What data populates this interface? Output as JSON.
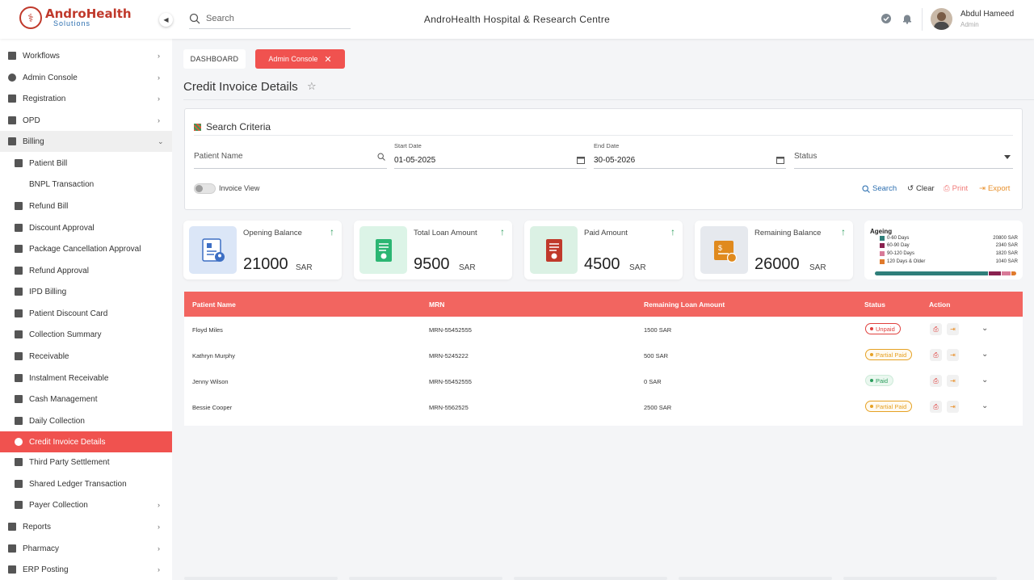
{
  "brand": {
    "name": "AndroHealth",
    "sub": "Solutions"
  },
  "header": {
    "search_placeholder": "Search",
    "hospital": "AndroHealth Hospital & Research Centre",
    "user_name": "Abdul Hameed",
    "user_role": "Admin"
  },
  "sidebar": {
    "items": [
      {
        "label": "Workflows",
        "chev": "›"
      },
      {
        "label": "Admin Console",
        "chev": "›"
      },
      {
        "label": "Registration",
        "chev": "›"
      },
      {
        "label": "OPD",
        "chev": "›"
      },
      {
        "label": "Billing",
        "chev": "⌄"
      },
      {
        "label": "Patient Bill"
      },
      {
        "label": "BNPL Transaction"
      },
      {
        "label": "Refund Bill"
      },
      {
        "label": "Discount Approval"
      },
      {
        "label": "Package Cancellation Approval"
      },
      {
        "label": "Refund Approval"
      },
      {
        "label": "IPD Billing"
      },
      {
        "label": "Patient Discount Card"
      },
      {
        "label": "Collection Summary"
      },
      {
        "label": "Receivable"
      },
      {
        "label": "Instalment Receivable"
      },
      {
        "label": "Cash Management"
      },
      {
        "label": "Daily Collection"
      },
      {
        "label": "Credit Invoice Details"
      },
      {
        "label": "Third Party Settlement"
      },
      {
        "label": "Shared Ledger Transaction"
      },
      {
        "label": "Payer Collection",
        "chev": "›"
      },
      {
        "label": "Reports",
        "chev": "›"
      },
      {
        "label": "Pharmacy",
        "chev": "›"
      },
      {
        "label": "ERP Posting",
        "chev": "›"
      }
    ]
  },
  "tabs": {
    "dashboard": "DASHBOARD",
    "admin": "Admin Console"
  },
  "page_title": "Credit Invoice Details",
  "criteria": {
    "title": "Search Criteria",
    "patient_placeholder": "Patient Name",
    "start_label": "Start Date",
    "start_value": "01-05-2025",
    "end_label": "End Date",
    "end_value": "30-05-2026",
    "status_placeholder": "Status",
    "invoice_view": "Invoice View",
    "actions": {
      "search": "Search",
      "clear": "Clear",
      "print": "Print",
      "export": "Export"
    }
  },
  "cards": [
    {
      "title": "Opening Balance",
      "value": "21000",
      "unit": "SAR",
      "color": "#3d6fc4"
    },
    {
      "title": "Total Loan Amount",
      "value": "9500",
      "unit": "SAR",
      "color": "#2bb673"
    },
    {
      "title": "Paid Amount",
      "value": "4500",
      "unit": "SAR",
      "color": "#c0392b"
    },
    {
      "title": "Remaining Balance",
      "value": "26000",
      "unit": "SAR",
      "color": "#e08a1e"
    }
  ],
  "ageing": {
    "title": "Ageing",
    "rows": [
      {
        "label": "0-60 Days",
        "amount": "20800 SAR",
        "value": 20800,
        "color": "#2f7f7a"
      },
      {
        "label": "60-90 Day",
        "amount": "2340 SAR",
        "value": 2340,
        "color": "#8a2250"
      },
      {
        "label": "90-120 Days",
        "amount": "1820 SAR",
        "value": 1820,
        "color": "#d87a98"
      },
      {
        "label": "120 Days & Older",
        "amount": "1040 SAR",
        "value": 1040,
        "color": "#e07a2c"
      }
    ]
  },
  "table": {
    "headers": [
      "Patient  Name",
      "MRN",
      "Remaining Loan Amount",
      "Status",
      "Action"
    ],
    "rows": [
      {
        "name": "Floyd Miles",
        "mrn": "MRN-55452555",
        "amount": "1500 SAR",
        "status": "Unpaid"
      },
      {
        "name": "Kathryn Murphy",
        "mrn": "MRN-5245222",
        "amount": "500 SAR",
        "status": "Partial Paid"
      },
      {
        "name": "Jenny Wilson",
        "mrn": "MRN-55452555",
        "amount": "0  SAR",
        "status": "Paid"
      },
      {
        "name": "Bessie Cooper",
        "mrn": "MRN-5562525",
        "amount": "2500 SAR",
        "status": "Partial Paid"
      }
    ]
  }
}
